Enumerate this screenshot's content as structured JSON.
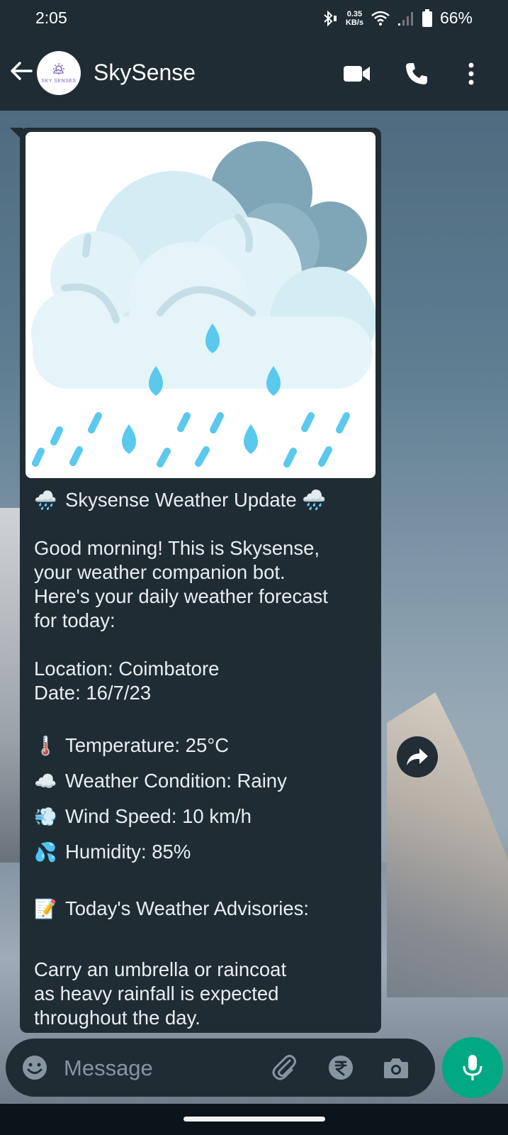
{
  "status_bar": {
    "time": "2:05",
    "net_speed_value": "0.35",
    "net_speed_unit": "KB/s",
    "battery": "66%",
    "icons": [
      "bluetooth-icon",
      "wifi-icon",
      "signal-icon",
      "battery-icon"
    ]
  },
  "header": {
    "title": "SkySense",
    "avatar_text": "SKY SENSES",
    "icons": [
      "back-arrow-icon",
      "video-call-icon",
      "phone-call-icon",
      "more-vert-icon"
    ]
  },
  "message": {
    "heading": "Skysense Weather Update",
    "heading_emoji": "🌧️",
    "greeting_lines": [
      "Good morning! This is Skysense,",
      "your weather companion bot.",
      "Here's your daily weather forecast",
      "for today:"
    ],
    "location": "Location: Coimbatore",
    "date": "Date: 16/7/23",
    "temperature": {
      "emoji": "🌡️",
      "text": "Temperature: 25°C"
    },
    "condition": {
      "emoji": "☁️",
      "text": "Weather Condition: Rainy"
    },
    "wind": {
      "emoji": "💨",
      "text": "Wind Speed: 10 km/h"
    },
    "humidity": {
      "emoji": "💦",
      "text": "Humidity: 85%"
    },
    "advisories_heading": {
      "emoji": "📝",
      "text": "Today's Weather Advisories:"
    },
    "advisory_lines": [
      "Carry an umbrella or raincoat",
      "as heavy rainfall is expected",
      "throughout the day."
    ]
  },
  "composer": {
    "placeholder": "Message",
    "icons": [
      "emoji-icon",
      "attach-icon",
      "rupee-icon",
      "camera-icon",
      "mic-icon"
    ]
  },
  "colors": {
    "header_bg": "#1f2c34",
    "bubble_bg": "#202c33",
    "mic_button": "#00a884",
    "text": "#e9edef",
    "placeholder": "#8696a0"
  }
}
